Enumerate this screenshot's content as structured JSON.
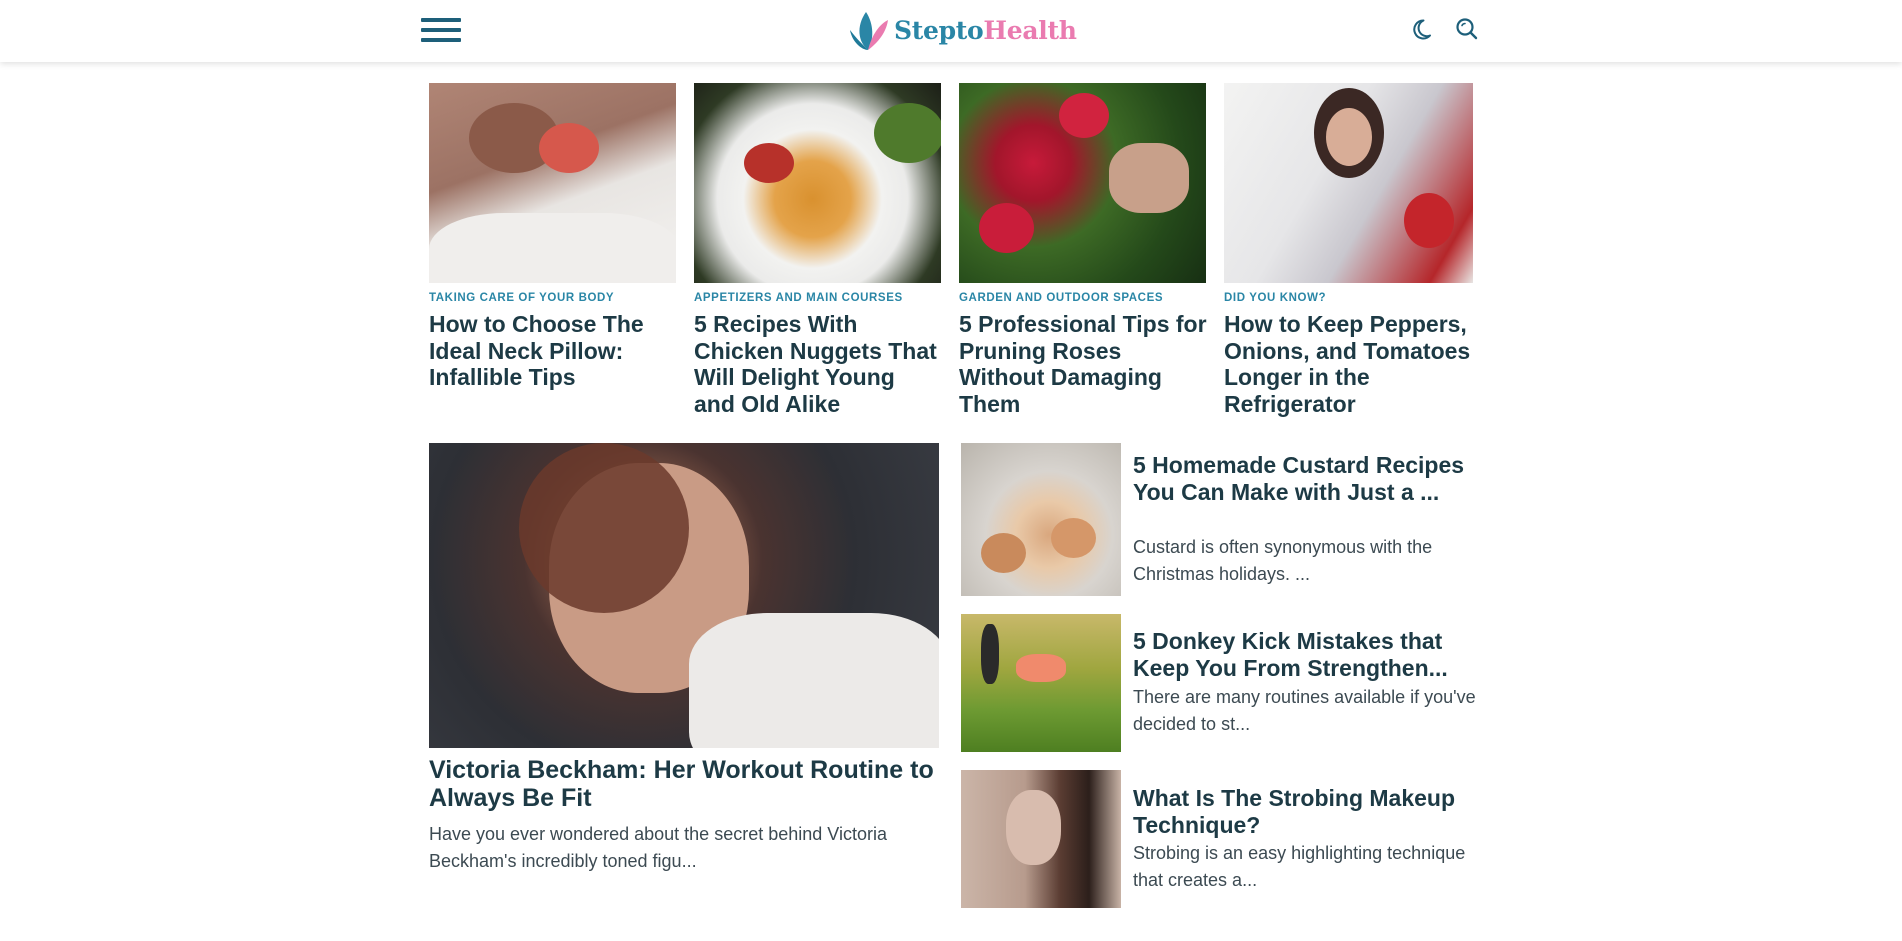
{
  "header": {
    "logo_part1": "Stepto",
    "logo_part2": "Health"
  },
  "top_cards": [
    {
      "category": "TAKING CARE OF YOUR BODY",
      "title": "How to Choose The Ideal Neck Pillow: Infallible Tips"
    },
    {
      "category": "APPETIZERS AND MAIN COURSES",
      "title": "5 Recipes With Chicken Nuggets That Will Delight Young and Old Alike"
    },
    {
      "category": "GARDEN AND OUTDOOR SPACES",
      "title": "5 Professional Tips for Pruning Roses Without Damaging Them"
    },
    {
      "category": "DID YOU KNOW?",
      "title": "How to Keep Peppers, Onions, and Tomatoes Longer in the Refrigerator"
    }
  ],
  "featured": {
    "title": "Victoria Beckham: Her Workout Routine to Always Be Fit",
    "excerpt": "Have you ever wondered about the secret behind Victoria Beckham's incredibly toned figu..."
  },
  "side_articles": [
    {
      "title": "5 Homemade Custard Recipes You Can Make with Just a ...",
      "excerpt": "Custard is often synonymous with the Christmas holidays. ..."
    },
    {
      "title": "5 Donkey Kick Mistakes that Keep You From Strengthen...",
      "excerpt": "There are many routines available if you've decided to st..."
    },
    {
      "title": "What Is The Strobing Makeup Technique?",
      "excerpt": "Strobing is an easy highlighting technique that creates a..."
    }
  ],
  "colors": {
    "brand_teal": "#2a86a6",
    "brand_pink": "#ea7bb0",
    "title_dark": "#1d3a45"
  },
  "icons": [
    "hamburger-menu-icon",
    "logo-icon",
    "moon-icon",
    "search-icon"
  ]
}
